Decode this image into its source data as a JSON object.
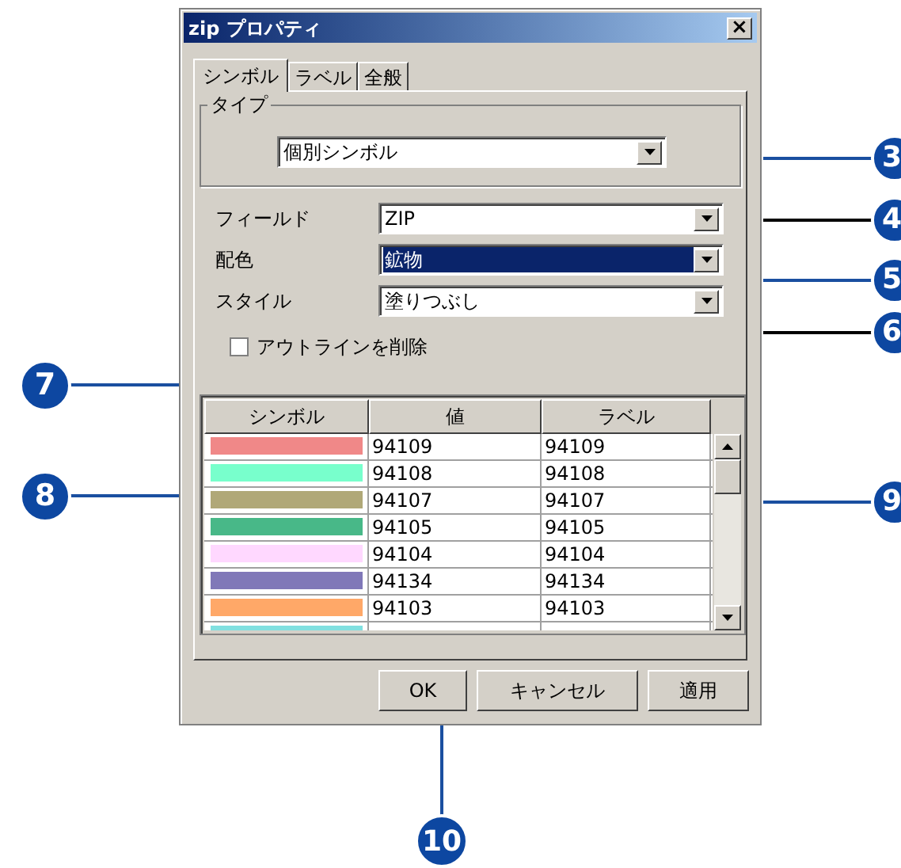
{
  "window": {
    "title": "zip プロパティ",
    "close": "×"
  },
  "tabs": [
    {
      "label": "シンボル",
      "selected": true
    },
    {
      "label": "ラベル",
      "selected": false
    },
    {
      "label": "全般",
      "selected": false
    }
  ],
  "type_group": {
    "legend": "タイプ",
    "value": "個別シンボル"
  },
  "fields": [
    {
      "label": "フィールド",
      "value": "ZIP",
      "highlighted": false
    },
    {
      "label": "配色",
      "value": "鉱物",
      "highlighted": true
    },
    {
      "label": "スタイル",
      "value": "塗りつぶし",
      "highlighted": false
    }
  ],
  "outline_checkbox": {
    "label": "アウトラインを削除",
    "checked": false
  },
  "table": {
    "columns": [
      "シンボル",
      "値",
      "ラベル"
    ],
    "rows": [
      {
        "color": "#f08888",
        "value": "94109",
        "label": "94109"
      },
      {
        "color": "#78ffcc",
        "value": "94108",
        "label": "94108"
      },
      {
        "color": "#b0a878",
        "value": "94107",
        "label": "94107"
      },
      {
        "color": "#48b888",
        "value": "94105",
        "label": "94105"
      },
      {
        "color": "#ffd8ff",
        "value": "94104",
        "label": "94104"
      },
      {
        "color": "#8078b8",
        "value": "94134",
        "label": "94134"
      },
      {
        "color": "#ffa868",
        "value": "94103",
        "label": "94103"
      },
      {
        "color": "#80e0e0"
      }
    ]
  },
  "buttons": [
    "OK",
    "キャンセル",
    "適用"
  ],
  "callouts": [
    {
      "label": "3",
      "kind": "right",
      "color": "#1a4fa0"
    },
    {
      "label": "4",
      "kind": "right",
      "color": "#000000"
    },
    {
      "label": "5",
      "kind": "right",
      "color": "#1a4fa0"
    },
    {
      "label": "6",
      "kind": "right",
      "color": "#000000"
    },
    {
      "label": "7",
      "kind": "left",
      "color": "#1a4fa0"
    },
    {
      "label": "8",
      "kind": "left",
      "color": "#1a4fa0"
    },
    {
      "label": "9",
      "kind": "right",
      "color": "#1a4fa0"
    },
    {
      "label": "10",
      "kind": "bottom",
      "color": "#1a4fa0"
    }
  ]
}
